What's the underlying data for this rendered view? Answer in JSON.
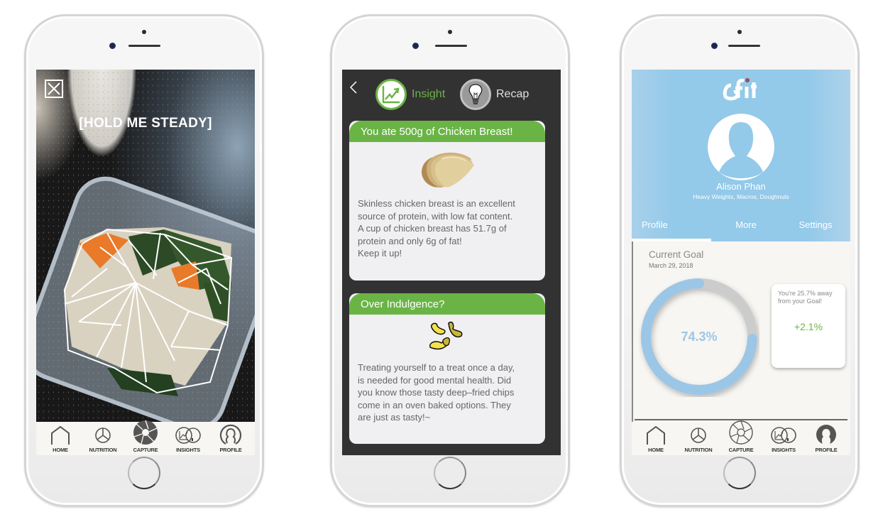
{
  "capture_screen": {
    "close_icon": "close-x-icon",
    "instruction": "[HOLD ME STEADY]",
    "tabbar": [
      {
        "label": "HOME",
        "icon": "home-icon"
      },
      {
        "label": "NUTRITION",
        "icon": "nutrition-icon"
      },
      {
        "label": "CAPTURE",
        "icon": "capture-shutter-icon",
        "active": true
      },
      {
        "label": "INSIGHTS",
        "icon": "insights-icon"
      },
      {
        "label": "PROFILE",
        "icon": "profile-icon"
      }
    ]
  },
  "insights_screen": {
    "back_icon": "chevron-left-icon",
    "tabs": [
      {
        "label": "Insight",
        "icon": "trend-chart-icon",
        "active": true,
        "color": "#6ab445"
      },
      {
        "label": "Recap",
        "icon": "lightbulb-icon",
        "active": false,
        "color": "#e0e0e0"
      }
    ],
    "cards": [
      {
        "title": "You ate 500g of Chicken Breast!",
        "image": "chicken-breast-icon",
        "body": [
          "Skinless chicken breast is an excellent",
          "source of protein, with low fat content.",
          "A cup of chicken breast has 51.7g of",
          "protein and only 6g of fat!",
          "Keep it up!"
        ]
      },
      {
        "title": "Over Indulgence?",
        "image": "chips-icon",
        "body": [
          "Treating yourself to a treat once a day,",
          "is needed for good mental health. Did",
          "you know those tasty deep–fried chips",
          "come in an oven baked options. They",
          "are just as tasty!~"
        ]
      }
    ]
  },
  "profile_screen": {
    "logo": "cfit",
    "user": {
      "name": "Alison Phan",
      "tags": "Heavy Weights, Macros, Doughnuts"
    },
    "tabs": [
      {
        "label": "Profile",
        "active": true
      },
      {
        "label": "More",
        "active": false
      },
      {
        "label": "Settings",
        "active": false
      }
    ],
    "goal": {
      "title": "Current Goal",
      "date": "March 29, 2018",
      "progress_percent": 74.3,
      "progress_label": "74.3%",
      "away_message": "You're 25.7% away from your Goal!",
      "delta": "+2.1%"
    },
    "colors": {
      "accent_blue": "#93c9e9",
      "ring_fill": "#9cc6e6",
      "ring_track": "#cccccc",
      "accent_green": "#6ab445"
    },
    "tabbar": [
      {
        "label": "HOME",
        "icon": "home-icon"
      },
      {
        "label": "NUTRITION",
        "icon": "nutrition-icon"
      },
      {
        "label": "CAPTURE",
        "icon": "capture-shutter-icon"
      },
      {
        "label": "INSIGHTS",
        "icon": "insights-icon"
      },
      {
        "label": "PROFILE",
        "icon": "profile-icon",
        "active": true
      }
    ]
  }
}
